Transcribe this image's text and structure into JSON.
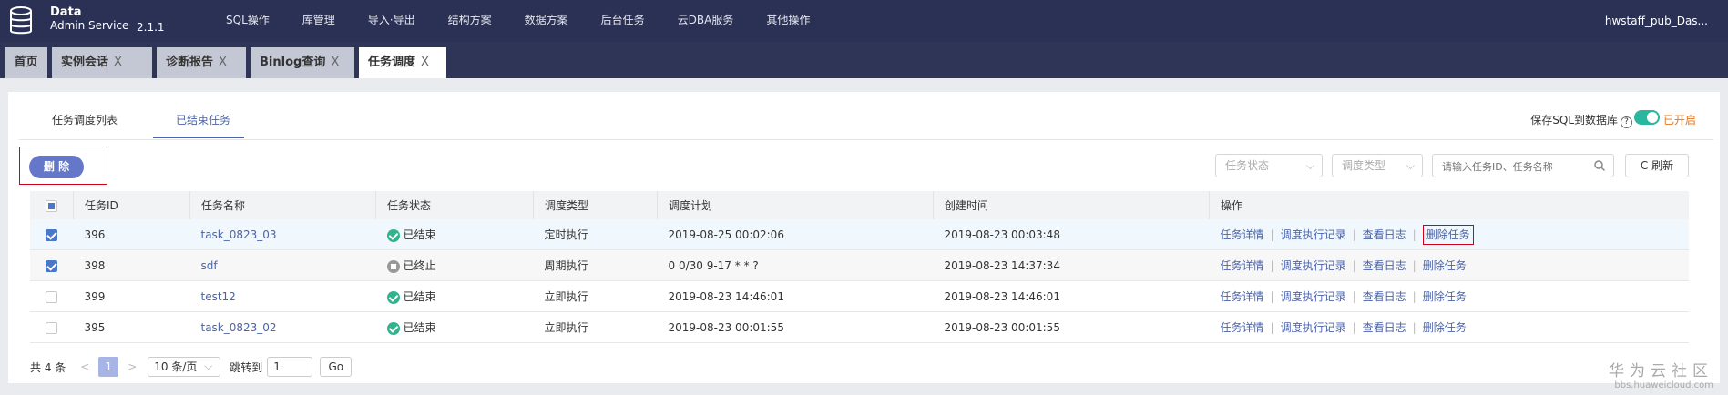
{
  "app": {
    "brand_line1": "Data",
    "brand_line2": "Admin Service",
    "version": "2.1.1",
    "user": "hwstaff_pub_Das..."
  },
  "nav": [
    "SQL操作",
    "库管理",
    "导入·导出",
    "结构方案",
    "数据方案",
    "后台任务",
    "云DBA服务",
    "其他操作"
  ],
  "tabs": [
    {
      "label": "首页",
      "close": ""
    },
    {
      "label": "实例会话",
      "close": "X"
    },
    {
      "label": "诊断报告",
      "close": "X"
    },
    {
      "label": "Binlog查询",
      "close": "X"
    },
    {
      "label": "任务调度",
      "close": "X"
    }
  ],
  "subtabs": [
    "任务调度列表",
    "已结束任务"
  ],
  "toolbar": {
    "save_sql": "保存SQL到数据库",
    "help": "?",
    "toggle_label": "已开启",
    "delete_label": "删 除",
    "status_select": "任务状态",
    "type_select": "调度类型",
    "search_placeholder": "请输入任务ID、任务名称",
    "refresh": "C 刷新"
  },
  "table": {
    "headers": [
      "任务ID",
      "任务名称",
      "任务状态",
      "调度类型",
      "调度计划",
      "创建时间",
      "操作"
    ],
    "actions": [
      "任务详情",
      "调度执行记录",
      "查看日志",
      "删除任务"
    ],
    "action_sep": "|",
    "rows": [
      {
        "id": "396",
        "name": "task_0823_03",
        "status": "已结束",
        "type": "定时执行",
        "plan": "2019-08-25 00:02:06",
        "created": "2019-08-23 00:03:48"
      },
      {
        "id": "398",
        "name": "sdf",
        "status": "已终止",
        "type": "周期执行",
        "plan": "0 0/30 9-17 * * ?",
        "created": "2019-08-23 14:37:34"
      },
      {
        "id": "399",
        "name": "test12",
        "status": "已结束",
        "type": "立即执行",
        "plan": "2019-08-23 14:46:01",
        "created": "2019-08-23 14:46:01"
      },
      {
        "id": "395",
        "name": "task_0823_02",
        "status": "已结束",
        "type": "立即执行",
        "plan": "2019-08-23 00:01:55",
        "created": "2019-08-23 00:01:55"
      }
    ]
  },
  "pager": {
    "total": "共 4 条",
    "prev": "<",
    "page": "1",
    "next": ">",
    "size": "10 条/页",
    "jump_label": "跳转到",
    "jump_value": "1",
    "go": "Go"
  },
  "watermark": {
    "line1": "华为云社区",
    "line2": "bbs.huaweicloud.com"
  },
  "colors": {
    "topbar": "#2b3155",
    "accent": "#4a63a9",
    "success": "#31b38b",
    "toggle_on": "#2bb6a0",
    "highlight": "#d0021b"
  }
}
